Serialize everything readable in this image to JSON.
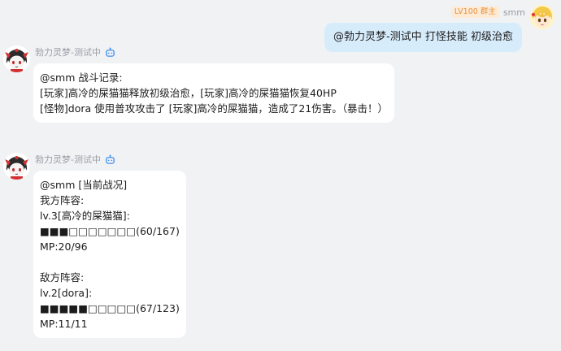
{
  "user_message": {
    "level_badge": "LV100 群主",
    "sender_name": "smm",
    "text": "@勃力灵梦-测试中 打怪技能 初级治愈"
  },
  "bot_messages": [
    {
      "sender_name": "勃力灵梦-测试中",
      "lines": [
        "@smm 战斗记录:",
        "[玩家]高冷的屎猫猫释放初级治愈，[玩家]高冷的屎猫猫恢复40HP",
        "[怪物]dora 使用普攻攻击了 [玩家]高冷的屎猫猫，造成了21伤害。（暴击！）"
      ]
    },
    {
      "sender_name": "勃力灵梦-测试中",
      "lines": [
        "@smm [当前战况]",
        "我方阵容:",
        "lv.3[高冷的屎猫猫]:",
        "■■■□□□□□□□(60/167)",
        "MP:20/96",
        "",
        "敌方阵容:",
        "lv.2[dora]:",
        "■■■■■□□□□□(67/123)",
        "MP:11/11"
      ]
    }
  ],
  "colors": {
    "background": "#f1f2f4",
    "user_bubble": "#d7ecfb",
    "bot_bubble": "#ffffff",
    "badge_bg": "#fdebd6",
    "badge_text": "#e9913f",
    "bot_icon": "#3b8df2",
    "name_text": "#999da3"
  },
  "icons": {
    "user_avatar": "blonde-anime-avatar",
    "bot_avatar": "reimu-chibi-avatar",
    "bot_badge": "robot-icon"
  }
}
